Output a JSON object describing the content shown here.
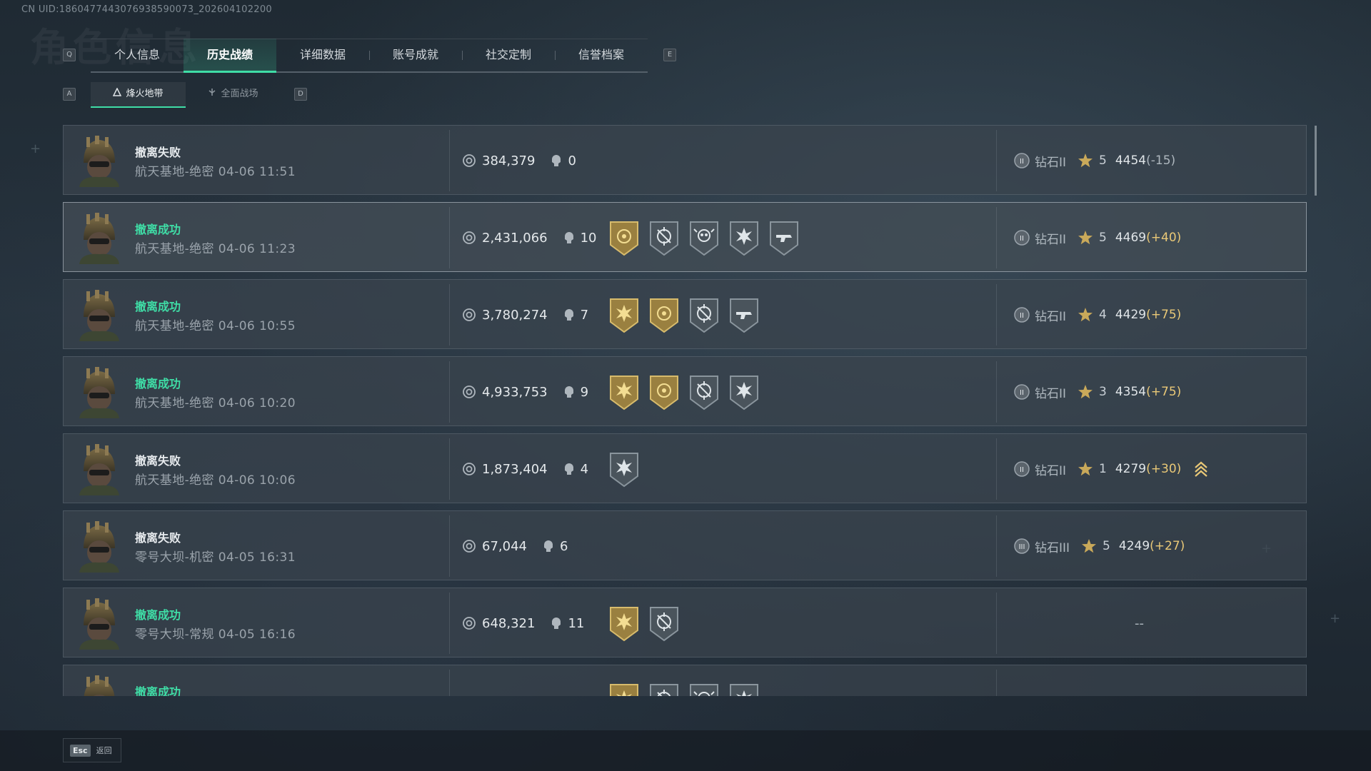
{
  "uid_text": "CN UID:1860477443076938590073_202604102200",
  "page_title": "角色信息",
  "key_hints": {
    "prev_tab": "Q",
    "next_tab": "E",
    "prev_sub": "A",
    "next_sub": "D"
  },
  "tabs": [
    {
      "label": "个人信息",
      "active": false
    },
    {
      "label": "历史战绩",
      "active": true
    },
    {
      "label": "详细数据",
      "active": false
    },
    {
      "label": "账号成就",
      "active": false
    },
    {
      "label": "社交定制",
      "active": false
    },
    {
      "label": "信誉档案",
      "active": false
    }
  ],
  "subtabs": [
    {
      "label": "烽火地带",
      "active": true
    },
    {
      "label": "全面战场",
      "active": false
    }
  ],
  "records": [
    {
      "status": "撤离失败",
      "success": false,
      "map": "航天基地-绝密",
      "time": "04-06 11:51",
      "value": "384,379",
      "kills": "0",
      "medals": [],
      "rank": "钻石II",
      "rank_roman": "II",
      "stars": "5",
      "score": "4454",
      "delta": "(-15)",
      "delta_color": "#aeb7be",
      "highlight": false,
      "promo": false
    },
    {
      "status": "撤离成功",
      "success": true,
      "map": "航天基地-绝密",
      "time": "04-06 11:23",
      "value": "2,431,066",
      "kills": "10",
      "medals": [
        "gold-coin-medal",
        "silver-crosshair-medal",
        "silver-skull-medal",
        "silver-burst-medal",
        "silver-gun-medal"
      ],
      "rank": "钻石II",
      "rank_roman": "II",
      "stars": "5",
      "score": "4469",
      "delta": "(+40)",
      "delta_color": "#e9c877",
      "highlight": true,
      "promo": false
    },
    {
      "status": "撤离成功",
      "success": true,
      "map": "航天基地-绝密",
      "time": "04-06 10:55",
      "value": "3,780,274",
      "kills": "7",
      "medals": [
        "gold-burst-medal",
        "gold-coin-medal",
        "silver-crosshair-medal",
        "silver-gun-medal"
      ],
      "rank": "钻石II",
      "rank_roman": "II",
      "stars": "4",
      "score": "4429",
      "delta": "(+75)",
      "delta_color": "#e9c877",
      "highlight": false,
      "promo": false
    },
    {
      "status": "撤离成功",
      "success": true,
      "map": "航天基地-绝密",
      "time": "04-06 10:20",
      "value": "4,933,753",
      "kills": "9",
      "medals": [
        "gold-burst-medal",
        "gold-coin-medal",
        "silver-crosshair-medal",
        "silver-burst-medal"
      ],
      "rank": "钻石II",
      "rank_roman": "II",
      "stars": "3",
      "score": "4354",
      "delta": "(+75)",
      "delta_color": "#e9c877",
      "highlight": false,
      "promo": false
    },
    {
      "status": "撤离失败",
      "success": false,
      "map": "航天基地-绝密",
      "time": "04-06 10:06",
      "value": "1,873,404",
      "kills": "4",
      "medals": [
        "silver-burst-medal"
      ],
      "rank": "钻石II",
      "rank_roman": "II",
      "stars": "1",
      "score": "4279",
      "delta": "(+30)",
      "delta_color": "#e9c877",
      "highlight": false,
      "promo": true
    },
    {
      "status": "撤离失败",
      "success": false,
      "map": "零号大坝-机密",
      "time": "04-05 16:31",
      "value": "67,044",
      "kills": "6",
      "medals": [],
      "rank": "钻石III",
      "rank_roman": "III",
      "stars": "5",
      "score": "4249",
      "delta": "(+27)",
      "delta_color": "#e9c877",
      "highlight": false,
      "promo": false
    },
    {
      "status": "撤离成功",
      "success": true,
      "map": "零号大坝-常规",
      "time": "04-05 16:16",
      "value": "648,321",
      "kills": "11",
      "medals": [
        "gold-burst-medal",
        "silver-crosshair-medal"
      ],
      "rank": "",
      "rank_roman": "",
      "stars": "",
      "score": "",
      "delta": "",
      "delta_color": "#aeb7be",
      "highlight": false,
      "promo": false,
      "empty_rank": "--"
    },
    {
      "status": "撤离成功",
      "success": true,
      "map": "",
      "time": "",
      "value": "",
      "kills": "",
      "medals": [
        "gold-burst-medal",
        "silver-crosshair-medal",
        "silver-skull-medal",
        "silver-burst-medal"
      ],
      "rank": "",
      "rank_roman": "",
      "stars": "",
      "score": "",
      "delta": "",
      "delta_color": "#aeb7be",
      "highlight": false,
      "promo": false
    }
  ],
  "footer": {
    "esc_key": "Esc",
    "esc_label": "返回"
  },
  "colors": {
    "accent": "#3fdda6",
    "gold": "#e9c877",
    "row_bg": "#3a444d"
  }
}
